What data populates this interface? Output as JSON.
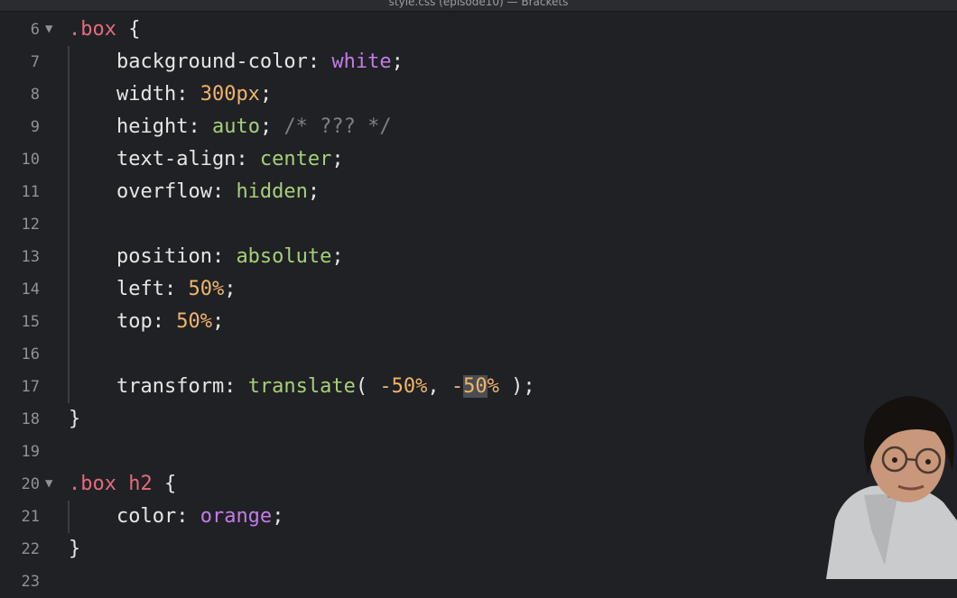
{
  "window": {
    "title": "style.css (episode10) — Brackets"
  },
  "lines": [
    {
      "num": "6",
      "fold": "▼",
      "parts": [
        {
          "t": ".box",
          "c": "sel"
        },
        {
          "t": " {",
          "c": "pun"
        }
      ]
    },
    {
      "num": "7",
      "fold": "",
      "parts": [
        {
          "t": "    background-color: ",
          "c": "prop"
        },
        {
          "t": "white",
          "c": "kw"
        },
        {
          "t": ";",
          "c": "pun"
        }
      ]
    },
    {
      "num": "8",
      "fold": "",
      "parts": [
        {
          "t": "    width: ",
          "c": "prop"
        },
        {
          "t": "300px",
          "c": "num"
        },
        {
          "t": ";",
          "c": "pun"
        }
      ]
    },
    {
      "num": "9",
      "fold": "",
      "parts": [
        {
          "t": "    height: ",
          "c": "prop"
        },
        {
          "t": "auto",
          "c": "val"
        },
        {
          "t": "; ",
          "c": "pun"
        },
        {
          "t": "/* ??? */",
          "c": "com"
        }
      ]
    },
    {
      "num": "10",
      "fold": "",
      "parts": [
        {
          "t": "    text-align: ",
          "c": "prop"
        },
        {
          "t": "center",
          "c": "val"
        },
        {
          "t": ";",
          "c": "pun"
        }
      ]
    },
    {
      "num": "11",
      "fold": "",
      "parts": [
        {
          "t": "    overflow: ",
          "c": "prop"
        },
        {
          "t": "hidden",
          "c": "val"
        },
        {
          "t": ";",
          "c": "pun"
        }
      ]
    },
    {
      "num": "12",
      "fold": "",
      "parts": []
    },
    {
      "num": "13",
      "fold": "",
      "parts": [
        {
          "t": "    position: ",
          "c": "prop"
        },
        {
          "t": "absolute",
          "c": "val"
        },
        {
          "t": ";",
          "c": "pun"
        }
      ]
    },
    {
      "num": "14",
      "fold": "",
      "parts": [
        {
          "t": "    left: ",
          "c": "prop"
        },
        {
          "t": "50%",
          "c": "num"
        },
        {
          "t": ";",
          "c": "pun"
        }
      ]
    },
    {
      "num": "15",
      "fold": "",
      "parts": [
        {
          "t": "    top: ",
          "c": "prop"
        },
        {
          "t": "50%",
          "c": "num"
        },
        {
          "t": ";",
          "c": "pun"
        }
      ]
    },
    {
      "num": "16",
      "fold": "",
      "parts": []
    },
    {
      "num": "17",
      "fold": "",
      "parts": [
        {
          "t": "    transform: ",
          "c": "prop"
        },
        {
          "t": "translate",
          "c": "val"
        },
        {
          "t": "( ",
          "c": "pun"
        },
        {
          "t": "-50%",
          "c": "num"
        },
        {
          "t": ", ",
          "c": "pun"
        },
        {
          "t": "-",
          "c": "num"
        },
        {
          "t": "50",
          "c": "num hl"
        },
        {
          "t": "%",
          "c": "num"
        },
        {
          "t": " );",
          "c": "pun"
        }
      ]
    },
    {
      "num": "18",
      "fold": "",
      "parts": [
        {
          "t": "}",
          "c": "pun"
        }
      ]
    },
    {
      "num": "19",
      "fold": "",
      "parts": []
    },
    {
      "num": "20",
      "fold": "▼",
      "parts": [
        {
          "t": ".box h2",
          "c": "sel"
        },
        {
          "t": " {",
          "c": "pun"
        }
      ]
    },
    {
      "num": "21",
      "fold": "",
      "parts": [
        {
          "t": "    color: ",
          "c": "prop"
        },
        {
          "t": "orange",
          "c": "kw"
        },
        {
          "t": ";",
          "c": "pun"
        }
      ]
    },
    {
      "num": "22",
      "fold": "",
      "parts": [
        {
          "t": "}",
          "c": "pun"
        }
      ]
    },
    {
      "num": "23",
      "fold": "",
      "parts": []
    }
  ]
}
